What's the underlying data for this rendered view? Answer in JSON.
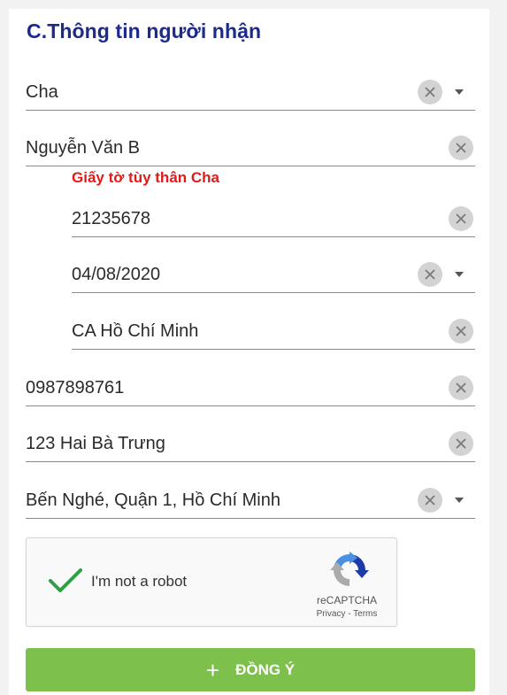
{
  "section": {
    "title": "C.Thông tin người nhận",
    "id_subhead": "Giấy tờ tùy thân Cha"
  },
  "fields": {
    "relation": "Cha",
    "full_name": "Nguyễn Văn B",
    "id_number": "21235678",
    "issue_date": "04/08/2020",
    "issue_place": "CA Hồ Chí Minh",
    "phone": "0987898761",
    "address": "123 Hai Bà Trưng",
    "area": "Bến Nghé, Quận 1, Hồ Chí Minh"
  },
  "recaptcha": {
    "label": "I'm not a robot",
    "brand": "reCAPTCHA",
    "links": "Privacy - Terms",
    "checked": true
  },
  "submit": {
    "icon": "plus-icon",
    "label": "ĐỒNG Ý",
    "color": "#7dc04b"
  },
  "colors": {
    "title": "#1c2a8c",
    "subhead": "#e21a1a",
    "check": "#2e9e47"
  }
}
